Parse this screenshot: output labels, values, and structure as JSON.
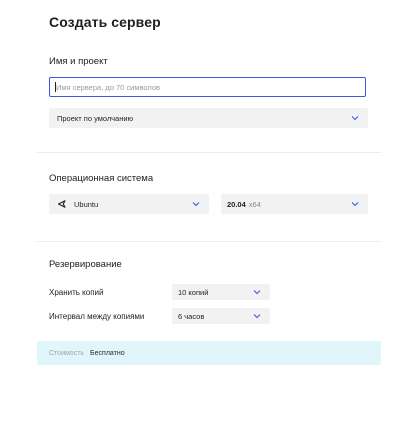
{
  "page": {
    "title": "Создать сервер"
  },
  "name_section": {
    "title": "Имя и проект",
    "server_name": {
      "value": "",
      "placeholder": "Имя сервера, до 70 символов"
    },
    "project_select": {
      "value": "Проект по умолчанию"
    }
  },
  "os_section": {
    "title": "Операционная система",
    "os_select": {
      "value": "Ubuntu",
      "icon": "ubuntu-icon"
    },
    "version_select": {
      "version": "20.04",
      "arch": "x64"
    }
  },
  "backup_section": {
    "title": "Резервирование",
    "copies": {
      "label": "Хранить копий",
      "value": "10 копий"
    },
    "interval": {
      "label": "Интервал между копиями",
      "value": "6 часов"
    }
  },
  "footer": {
    "cost_label": "Стоимость",
    "cost_value": "Бесплатно"
  },
  "colors": {
    "accent": "#3b57e6",
    "select_bg": "#f2f2f2",
    "footer_bg": "#e0f6fb"
  }
}
